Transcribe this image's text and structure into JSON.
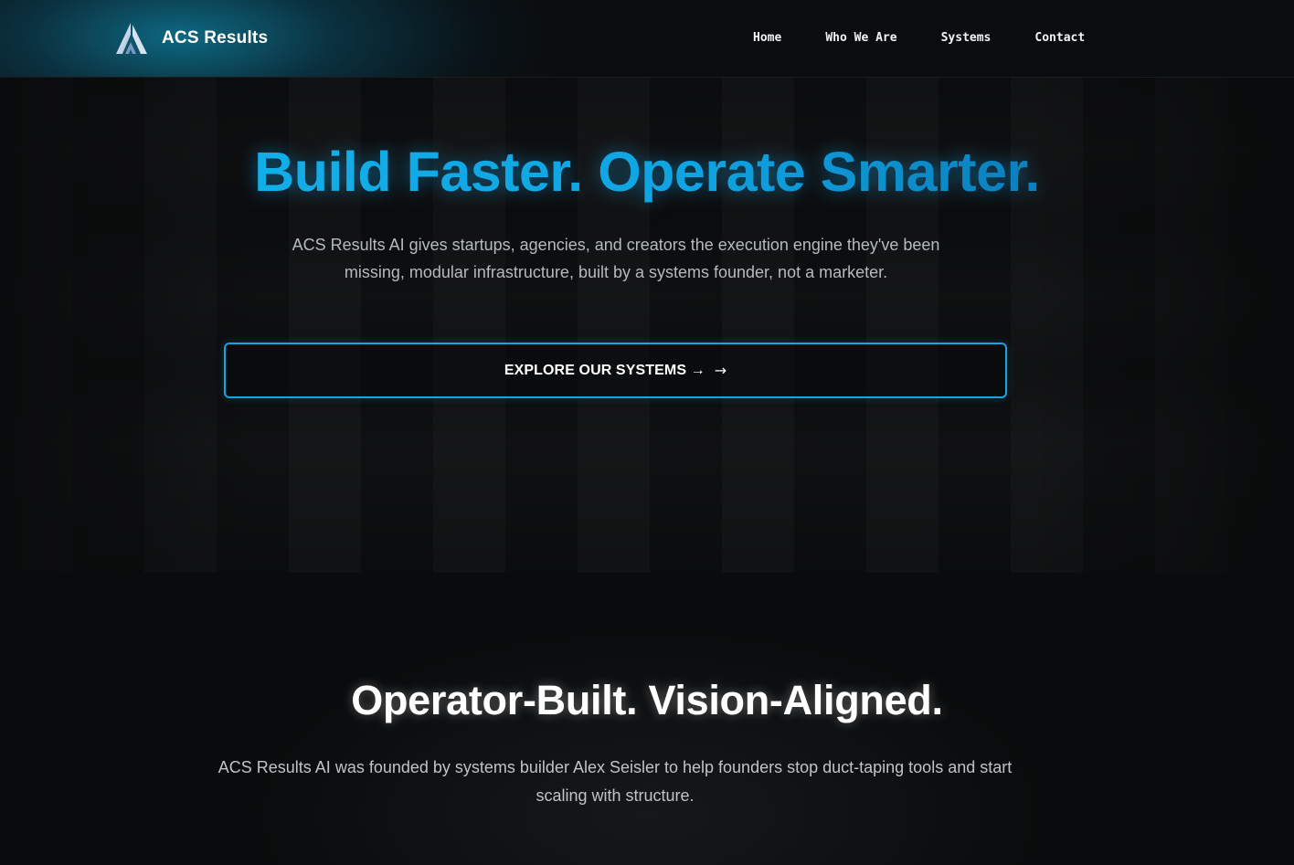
{
  "header": {
    "brand_name": "ACS Results",
    "logo_icon": "acs-a-mountain-logo",
    "nav": [
      {
        "label": "Home"
      },
      {
        "label": "Who We Are"
      },
      {
        "label": "Systems"
      },
      {
        "label": "Contact"
      }
    ]
  },
  "hero": {
    "title": "Build Faster. Operate Smarter.",
    "subtitle": "ACS Results AI gives startups, agencies, and creators the execution engine they've been missing, modular infrastructure, built by a systems founder, not a marketer.",
    "cta_label": "EXPLORE OUR SYSTEMS →",
    "cta_arrow": "→"
  },
  "about": {
    "title": "Operator-Built. Vision-Aligned.",
    "text": "ACS Results AI was founded by systems builder Alex Seisler to help founders stop duct-taping tools and start scaling with structure."
  },
  "colors": {
    "accent": "#14a6df",
    "background": "#0a0b0c",
    "nav_glow": "#0e7896"
  }
}
